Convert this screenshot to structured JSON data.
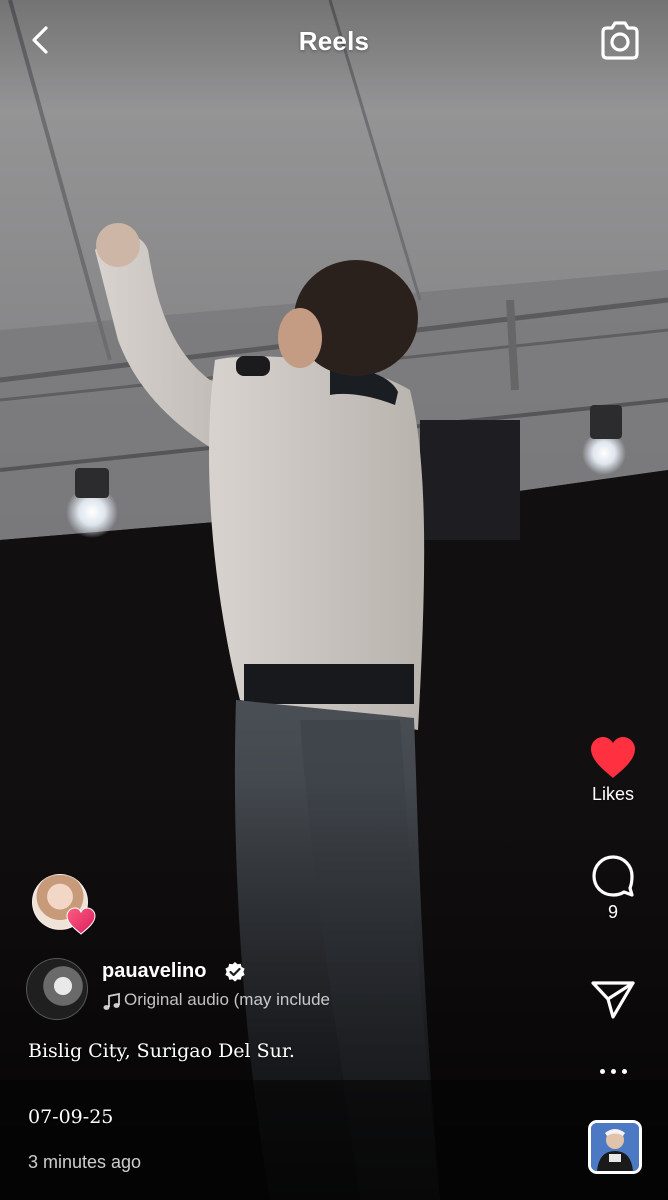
{
  "header": {
    "title": "Reels",
    "back_icon": "chevron-left-icon",
    "camera_icon": "camera-icon"
  },
  "rail": {
    "like_label": "Likes",
    "like_icon": "heart-icon",
    "like_color": "#ff3040",
    "liked": true,
    "comment_count": "9",
    "comment_icon": "comment-icon",
    "share_icon": "paper-plane-icon",
    "more_icon": "more-dots-icon"
  },
  "post": {
    "username": "pauavelino",
    "verified": true,
    "audio_text": "Original audio  (may include",
    "caption": "Bislig City, Surigao Del Sur.",
    "date_text": "07-09-25",
    "time_ago": "3 minutes ago"
  },
  "colors": {
    "verified_blue": "#3897f0",
    "heart_red": "#ff3040"
  }
}
